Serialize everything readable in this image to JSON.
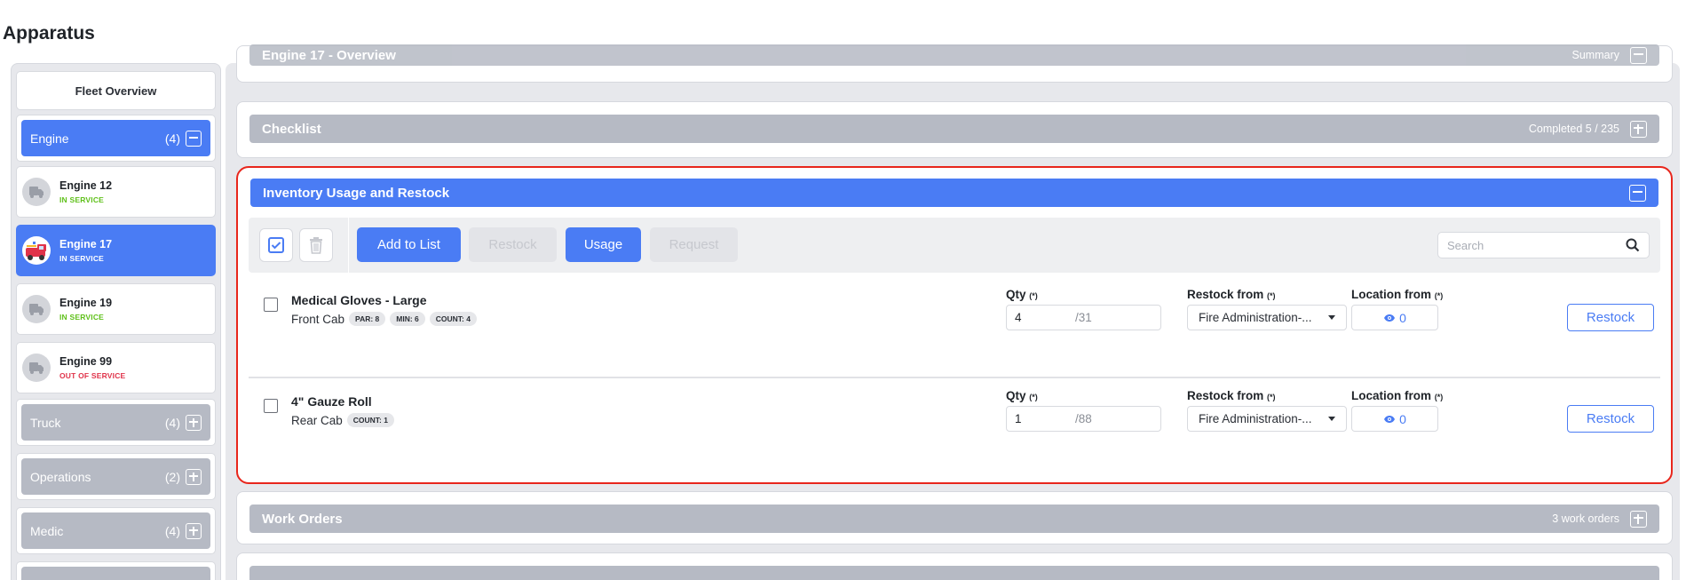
{
  "page_title": "Apparatus",
  "sidebar": {
    "fleet_overview": "Fleet Overview",
    "engine_group": {
      "label": "Engine",
      "count": "(4)"
    },
    "vehicles": [
      {
        "name": "Engine 12",
        "status": "IN SERVICE"
      },
      {
        "name": "Engine 17",
        "status": "IN SERVICE"
      },
      {
        "name": "Engine 19",
        "status": "IN SERVICE"
      },
      {
        "name": "Engine 99",
        "status": "OUT OF SERVICE"
      }
    ],
    "groups": [
      {
        "label": "Truck",
        "count": "(4)"
      },
      {
        "label": "Operations",
        "count": "(2)"
      },
      {
        "label": "Medic",
        "count": "(4)"
      }
    ]
  },
  "sections": {
    "overview": {
      "title": "Engine 17 - Overview",
      "meta": "Summary"
    },
    "checklist": {
      "title": "Checklist",
      "meta": "Completed 5 / 235"
    },
    "inventory": {
      "title": "Inventory Usage and Restock"
    },
    "work_orders": {
      "title": "Work Orders",
      "meta": "3 work orders"
    }
  },
  "toolbar": {
    "add_to_list": "Add to List",
    "restock": "Restock",
    "usage": "Usage",
    "request": "Request",
    "search_placeholder": "Search"
  },
  "labels": {
    "qty": "Qty",
    "restock_from": "Restock from",
    "location_from": "Location from",
    "required": "(*)",
    "restock_button": "Restock"
  },
  "items": [
    {
      "name": "Medical Gloves - Large",
      "location": "Front Cab",
      "badges": [
        "PAR: 8",
        "MIN: 6",
        "COUNT: 4"
      ],
      "qty": "4",
      "qty_total": "/31",
      "restock_from": "Fire Administration-...",
      "location_count": "0"
    },
    {
      "name": "4\" Gauze Roll",
      "location": "Rear Cab",
      "badges": [
        "COUNT: 1"
      ],
      "qty": "1",
      "qty_total": "/88",
      "restock_from": "Fire Administration-...",
      "location_count": "0"
    }
  ],
  "colors": {
    "accent": "#4a7cf4",
    "inactive_bar": "#b6bac4",
    "highlight_border": "#e8261c",
    "in_service": "#5fc01a",
    "out_of_service": "#e0334a"
  },
  "icons": [
    "truck-icon",
    "fire-engine-icon",
    "checkbox-icon",
    "trash-icon",
    "search-icon",
    "eye-icon",
    "plus-icon",
    "minus-icon"
  ]
}
